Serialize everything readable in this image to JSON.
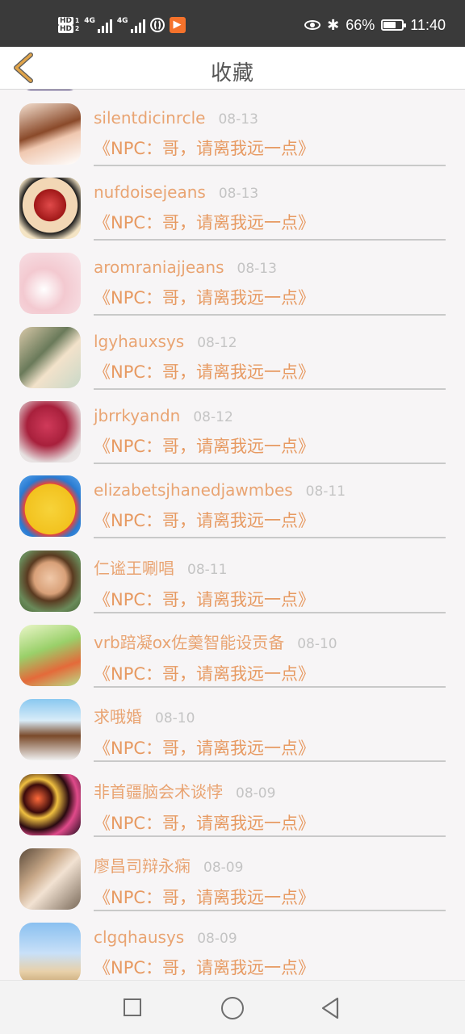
{
  "status_bar": {
    "hd1": "HD",
    "hd1_sub": "1",
    "hd2": "HD",
    "hd2_sub": "2",
    "net1": "4G",
    "net2": "4G",
    "app_badge": "▶",
    "bluetooth": "✱",
    "battery_percent": "66%",
    "battery_level": 0.66,
    "time": "11:40"
  },
  "header": {
    "title": "收藏",
    "accent_color": "#e0a44a"
  },
  "favorites": [
    {
      "user": "silentdicinrcle",
      "date": "08-13",
      "book": "《NPC：哥，请离我远一点》"
    },
    {
      "user": "nufdoisejeans",
      "date": "08-13",
      "book": "《NPC：哥，请离我远一点》"
    },
    {
      "user": "aromraniajjeans",
      "date": "08-13",
      "book": "《NPC：哥，请离我远一点》"
    },
    {
      "user": "lgyhauxsys",
      "date": "08-12",
      "book": "《NPC：哥，请离我远一点》"
    },
    {
      "user": "jbrrkyandn",
      "date": "08-12",
      "book": "《NPC：哥，请离我远一点》"
    },
    {
      "user": "elizabetsjhanedjawmbes",
      "date": "08-11",
      "book": "《NPC：哥，请离我远一点》"
    },
    {
      "user": "仁谧王唰唱",
      "date": "08-11",
      "book": "《NPC：哥，请离我远一点》"
    },
    {
      "user": "vrb踣凝ox佐羹智能设贡备",
      "date": "08-10",
      "book": "《NPC：哥，请离我远一点》"
    },
    {
      "user": "求哦婚",
      "date": "08-10",
      "book": "《NPC：哥，请离我远一点》"
    },
    {
      "user": "非首疆脑会术谈悖",
      "date": "08-09",
      "book": "《NPC：哥，请离我远一点》"
    },
    {
      "user": "廖昌司辩永痫",
      "date": "08-09",
      "book": "《NPC：哥，请离我远一点》"
    },
    {
      "user": "clgqhausys",
      "date": "08-09",
      "book": "《NPC：哥，请离我远一点》"
    }
  ],
  "colors": {
    "name": "#e9a472",
    "book": "#e79a62",
    "date": "#c4c4c4"
  }
}
